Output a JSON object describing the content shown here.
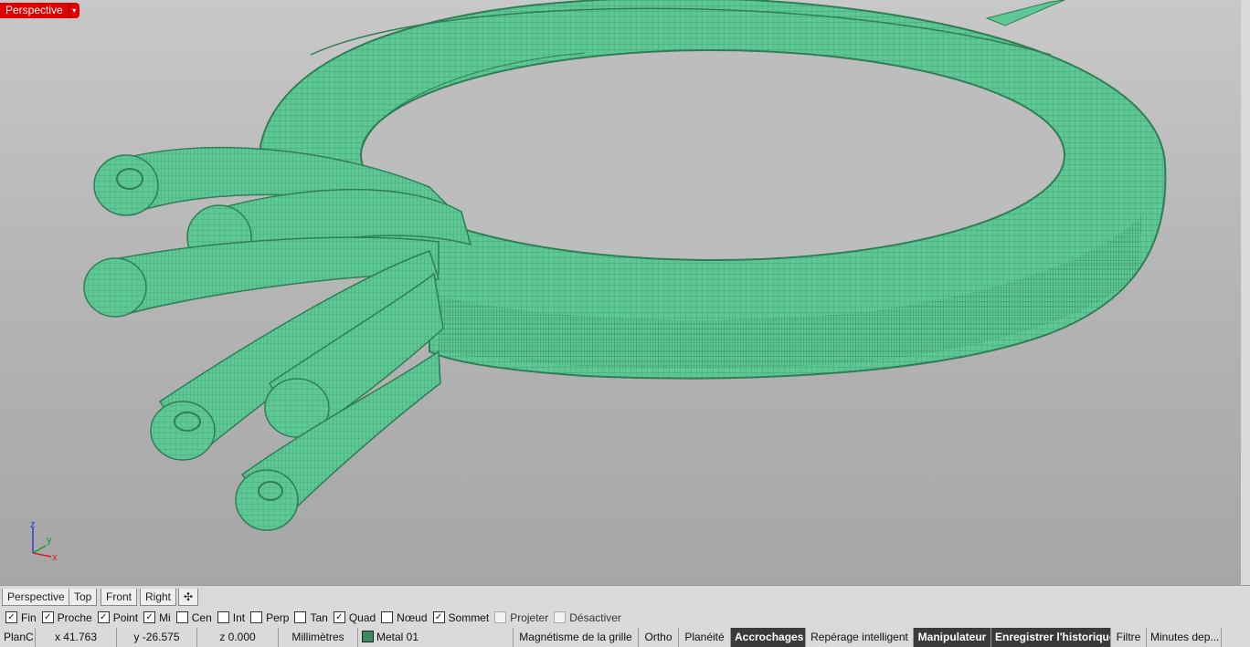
{
  "viewport": {
    "title": "Perspective",
    "dropdown_glyph": "▾",
    "mesh_color": "#5dc896",
    "mesh_line": "#2f7e54",
    "accent": "#e00000"
  },
  "axis": {
    "z": "z",
    "y": "y",
    "x": "x"
  },
  "view_tabs": [
    "Perspective",
    "Top",
    "Front",
    "Right"
  ],
  "add_tab_glyph": "✣",
  "osnaps": [
    {
      "label": "Fin",
      "checked": true
    },
    {
      "label": "Proche",
      "checked": true
    },
    {
      "label": "Point",
      "checked": true
    },
    {
      "label": "Mi",
      "checked": true
    },
    {
      "label": "Cen",
      "checked": false
    },
    {
      "label": "Int",
      "checked": false
    },
    {
      "label": "Perp",
      "checked": false
    },
    {
      "label": "Tan",
      "checked": false
    },
    {
      "label": "Quad",
      "checked": true
    },
    {
      "label": "Nœud",
      "checked": false
    },
    {
      "label": "Sommet",
      "checked": true
    },
    {
      "label": "Projeter",
      "checked": false,
      "disabled": true
    },
    {
      "label": "Désactiver",
      "checked": false,
      "disabled": true
    }
  ],
  "status": {
    "cplane": "PlanC",
    "x": "x 41.763",
    "y": "y -26.575",
    "z": "z 0.000",
    "units": "Millimètres",
    "layer": "Metal 01",
    "grid_snap": "Magnétisme de la grille",
    "ortho": "Ortho",
    "planar": "Planéité",
    "osnap": "Accrochages",
    "smarttrack": "Repérage intelligent",
    "gumball": "Manipulateur",
    "history": "Enregistrer l'historique",
    "filter": "Filtre",
    "minutes": "Minutes dep..."
  }
}
